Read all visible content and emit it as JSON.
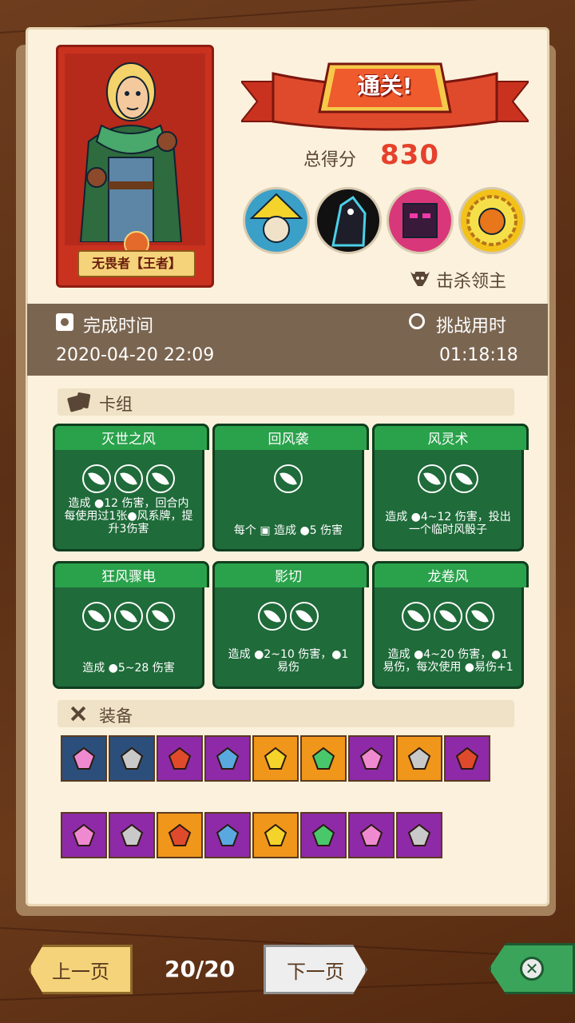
{
  "result": {
    "banner": "通关!",
    "score_label": "总得分",
    "score": "830"
  },
  "hero": {
    "name": "无畏者【王者】"
  },
  "bosses": {
    "label": "击杀领主",
    "portraits": [
      "boss-1",
      "boss-2",
      "boss-3",
      "boss-4"
    ]
  },
  "time": {
    "finish_label": "完成时间",
    "finish_value": "2020-04-20 22:09",
    "duration_label": "挑战用时",
    "duration_value": "01:18:18"
  },
  "deck": {
    "title": "卡组",
    "cards": [
      {
        "name": "灭世之风",
        "cost": 3,
        "desc_lines": [
          "造成 ●12 伤害，回合内",
          "每使用过1张●风系牌，提",
          "升3伤害"
        ]
      },
      {
        "name": "回风袭",
        "cost": 1,
        "desc_lines": [
          "每个 ▣ 造成 ●5 伤害"
        ]
      },
      {
        "name": "风灵术",
        "cost": 2,
        "desc_lines": [
          "造成 ●4~12 伤害，投出",
          "一个临时风骰子"
        ]
      },
      {
        "name": "狂风骤电",
        "cost": 3,
        "desc_lines": [
          "造成 ●5~28 伤害"
        ]
      },
      {
        "name": "影切",
        "cost": 2,
        "desc_lines": [
          "造成 ●2~10 伤害，●1",
          "易伤"
        ]
      },
      {
        "name": "龙卷风",
        "cost": 3,
        "desc_lines": [
          "造成 ●4~20 伤害，●1",
          "易伤，每次使用 ●易伤+1"
        ]
      }
    ]
  },
  "equipment": {
    "title": "装备",
    "row1": [
      {
        "icon": "rocket-skull-icon",
        "bg": "#2b4f7a"
      },
      {
        "icon": "shield-gem-icon",
        "bg": "#2b4f7a"
      },
      {
        "icon": "mirror-icon",
        "bg": "#8e2aa8"
      },
      {
        "icon": "spiked-cheese-icon",
        "bg": "#8e2aa8"
      },
      {
        "icon": "crystal-skull-icon",
        "bg": "#f0961a"
      },
      {
        "icon": "green-serpent-icon",
        "bg": "#f0961a"
      },
      {
        "icon": "tiki-mask-icon",
        "bg": "#8e2aa8"
      },
      {
        "icon": "green-feather-icon",
        "bg": "#f0961a"
      },
      {
        "icon": "emerald-icon",
        "bg": "#8e2aa8"
      }
    ],
    "row2": [
      {
        "icon": "golden-heart-icon",
        "bg": "#8e2aa8"
      },
      {
        "icon": "crow-skull-icon",
        "bg": "#8e2aa8"
      },
      {
        "icon": "blue-crystal-icon",
        "bg": "#f0961a"
      },
      {
        "icon": "heart-amulet-icon",
        "bg": "#8e2aa8"
      },
      {
        "icon": "green-stone-icon",
        "bg": "#f0961a"
      },
      {
        "icon": "crown-armor-icon",
        "bg": "#8e2aa8"
      },
      {
        "icon": "golden-die-icon",
        "bg": "#8e2aa8"
      },
      {
        "icon": "ruby-pendant-icon",
        "bg": "#8e2aa8"
      }
    ]
  },
  "pager": {
    "prev": "上一页",
    "next": "下一页",
    "indicator": "20/20"
  }
}
